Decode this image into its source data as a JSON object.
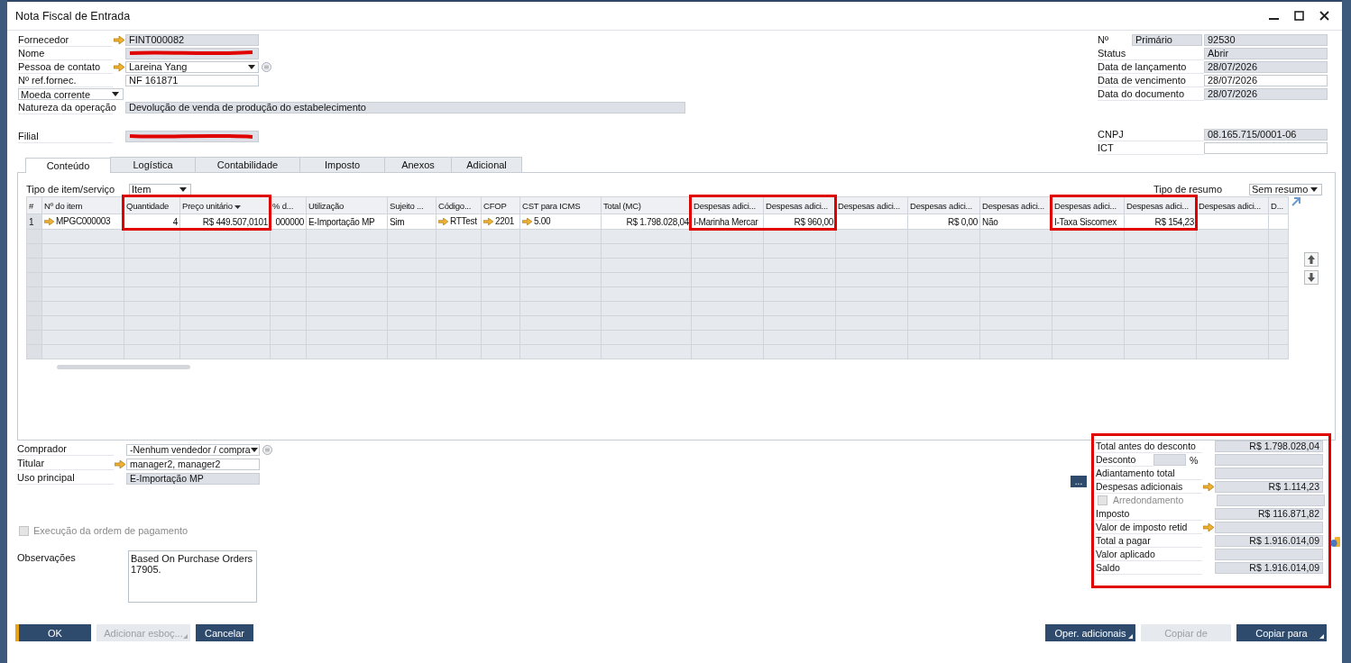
{
  "window": {
    "title": "Nota Fiscal de Entrada"
  },
  "header_left": [
    {
      "label": "Fornecedor",
      "kind": "field",
      "link_arrow": true,
      "value": "FINT000082",
      "readonly": true
    },
    {
      "label": "Nome",
      "kind": "field",
      "link_arrow": false,
      "readonly": true,
      "redacted": true
    },
    {
      "label": "Pessoa de contato",
      "kind": "dropdown",
      "link_arrow": true,
      "value": "Lareina Yang",
      "readonly": false,
      "info": true
    },
    {
      "label": "Nº ref.fornec.",
      "kind": "field",
      "link_arrow": false,
      "value": "NF 161871",
      "readonly": false
    },
    {
      "label": "Moeda corrente",
      "kind": "label_dropdown"
    },
    {
      "label": "Natureza da operação",
      "kind": "wide",
      "link_arrow": false,
      "value": "Devolução de venda de produção do estabelecimento",
      "readonly": true
    }
  ],
  "branch": {
    "label": "Filial",
    "kind": "field",
    "link_arrow": false,
    "readonly": true,
    "redacted": true
  },
  "header_right": {
    "number": {
      "label": "Nº",
      "series": "Primário",
      "value": "92530"
    },
    "rows": [
      {
        "label": "Status",
        "value": "Abrir",
        "readonly": true
      },
      {
        "label": "Data de lançamento",
        "value": "28/07/2026",
        "readonly": true
      },
      {
        "label": "Data de vencimento",
        "value": "28/07/2026",
        "readonly": false
      },
      {
        "label": "Data do documento",
        "value": "28/07/2026",
        "readonly": true
      }
    ],
    "tax_rows": [
      {
        "label": "CNPJ",
        "value": "08.165.715/0001-06",
        "readonly": true
      },
      {
        "label": "ICT",
        "readonly": false
      }
    ]
  },
  "tabs": [
    {
      "label": "Conteúdo",
      "selected": true
    },
    {
      "label": "Logística",
      "selected": false
    },
    {
      "label": "Contabilidade",
      "selected": false
    },
    {
      "label": "Imposto",
      "selected": false
    },
    {
      "label": "Anexos",
      "selected": false
    },
    {
      "label": "Adicional",
      "selected": false
    }
  ],
  "item_type": {
    "label": "Tipo de item/serviço",
    "value": "Item"
  },
  "summary_type": {
    "label": "Tipo de resumo",
    "value": "Sem resumo"
  },
  "table": {
    "columns": [
      {
        "label": "#",
        "highlighted": false
      },
      {
        "label": "Nº do item",
        "highlighted": false
      },
      {
        "label": "Quantidade",
        "highlighted": true
      },
      {
        "label": "Preço unitário",
        "highlighted": true,
        "sort": true
      },
      {
        "label": "% d...",
        "highlighted": false
      },
      {
        "label": "Utilização",
        "highlighted": false
      },
      {
        "label": "Sujeito ...",
        "highlighted": false
      },
      {
        "label": "Código...",
        "highlighted": false
      },
      {
        "label": "CFOP",
        "highlighted": false
      },
      {
        "label": "CST para ICMS",
        "highlighted": false
      },
      {
        "label": "Total (MC)",
        "highlighted": false
      },
      {
        "label": "Despesas adici...",
        "highlighted": true
      },
      {
        "label": "Despesas adici...",
        "highlighted": true
      },
      {
        "label": "Despesas adici...",
        "highlighted": false
      },
      {
        "label": "Despesas adici...",
        "highlighted": false
      },
      {
        "label": "Despesas adici...",
        "highlighted": false
      },
      {
        "label": "Despesas adici...",
        "highlighted": true
      },
      {
        "label": "Despesas adici...",
        "highlighted": true
      },
      {
        "label": "Despesas adici...",
        "highlighted": false
      },
      {
        "label": "D...",
        "highlighted": false
      }
    ],
    "rows": [
      {
        "cells": [
          {
            "text": "1",
            "numeric": false,
            "link_arrow": false
          },
          {
            "text": "MPGC000003",
            "numeric": false,
            "link_arrow": true
          },
          {
            "text": "4",
            "numeric": true,
            "link_arrow": false
          },
          {
            "text": "R$ 449.507,0101",
            "numeric": true,
            "link_arrow": false
          },
          {
            "text": "000000",
            "numeric": true,
            "link_arrow": false
          },
          {
            "text": "E-Importação MP",
            "numeric": false,
            "link_arrow": false
          },
          {
            "text": "Sim",
            "numeric": false,
            "link_arrow": false
          },
          {
            "text": "RTTest",
            "numeric": false,
            "link_arrow": true
          },
          {
            "text": "2201",
            "numeric": false,
            "link_arrow": true
          },
          {
            "text": "5.00",
            "numeric": false,
            "link_arrow": true
          },
          {
            "text": "R$ 1.798.028,04",
            "numeric": true,
            "link_arrow": false
          },
          {
            "text": "I-Marinha Mercar",
            "numeric": false,
            "link_arrow": false
          },
          {
            "text": "R$ 960,00",
            "numeric": true,
            "link_arrow": false
          },
          {},
          {
            "text": "R$ 0,00",
            "numeric": true,
            "link_arrow": false
          },
          {
            "text": "Não",
            "numeric": false,
            "link_arrow": false
          },
          {
            "text": "I-Taxa Siscomex",
            "numeric": false,
            "link_arrow": false
          },
          {
            "text": "R$ 154,23",
            "numeric": true,
            "link_arrow": false
          },
          {},
          {}
        ]
      }
    ]
  },
  "footer_left": [
    {
      "label": "Comprador",
      "kind": "dropdown",
      "link_arrow": false,
      "value": "-Nenhum vendedor / compra",
      "readonly": false,
      "info": true
    },
    {
      "label": "Titular",
      "kind": "field",
      "link_arrow": true,
      "value": "manager2, manager2",
      "readonly": false
    },
    {
      "label": "Uso principal",
      "kind": "field",
      "link_arrow": false,
      "value": "E-Importação MP",
      "readonly": true
    }
  ],
  "payment_order": {
    "label": "Execução da ordem de pagamento",
    "checked": false,
    "disabled": true
  },
  "remarks": {
    "label": "Observações",
    "value": "Based On Purchase Orders\n17905."
  },
  "more_button": "...",
  "totals": {
    "highlighted": true,
    "rows": [
      {
        "kind": "value",
        "label": "Total antes do desconto",
        "value": "R$ 1.798.028,04",
        "link_arrow": false
      },
      {
        "kind": "discount",
        "label": "Desconto",
        "unit": "%"
      },
      {
        "kind": "value",
        "label": "Adiantamento total",
        "link_arrow": false
      },
      {
        "kind": "value",
        "label": "Despesas adicionais",
        "value": "R$ 1.114,23",
        "link_arrow": true
      },
      {
        "kind": "checkbox",
        "label": "Arredondamento",
        "checked": false,
        "disabled": true
      },
      {
        "kind": "value",
        "label": "Imposto",
        "value": "R$ 116.871,82",
        "link_arrow": false
      },
      {
        "kind": "value",
        "label": "Valor de imposto retid",
        "link_arrow": true
      },
      {
        "kind": "value",
        "label": "Total a pagar",
        "value": "R$ 1.916.014,09",
        "link_arrow": false,
        "coins": true
      },
      {
        "kind": "value",
        "label": "Valor aplicado",
        "link_arrow": false
      },
      {
        "kind": "value",
        "label": "Saldo",
        "value": "R$ 1.916.014,09",
        "link_arrow": false
      }
    ]
  },
  "buttons_left": [
    {
      "label": "OK",
      "kind": "primary",
      "disabled": false,
      "menu": false
    },
    {
      "label": "Adicionar esboç...",
      "kind": "normal",
      "disabled": true,
      "menu": true
    },
    {
      "label": "Cancelar",
      "kind": "normal",
      "disabled": false,
      "menu": false
    }
  ],
  "buttons_right": [
    {
      "label": "Oper. adicionais",
      "kind": "normal",
      "disabled": false,
      "menu": true
    },
    {
      "label": "Copiar de",
      "kind": "normal",
      "disabled": true,
      "menu": false
    },
    {
      "label": "Copiar para",
      "kind": "normal",
      "disabled": false,
      "menu": true
    }
  ]
}
